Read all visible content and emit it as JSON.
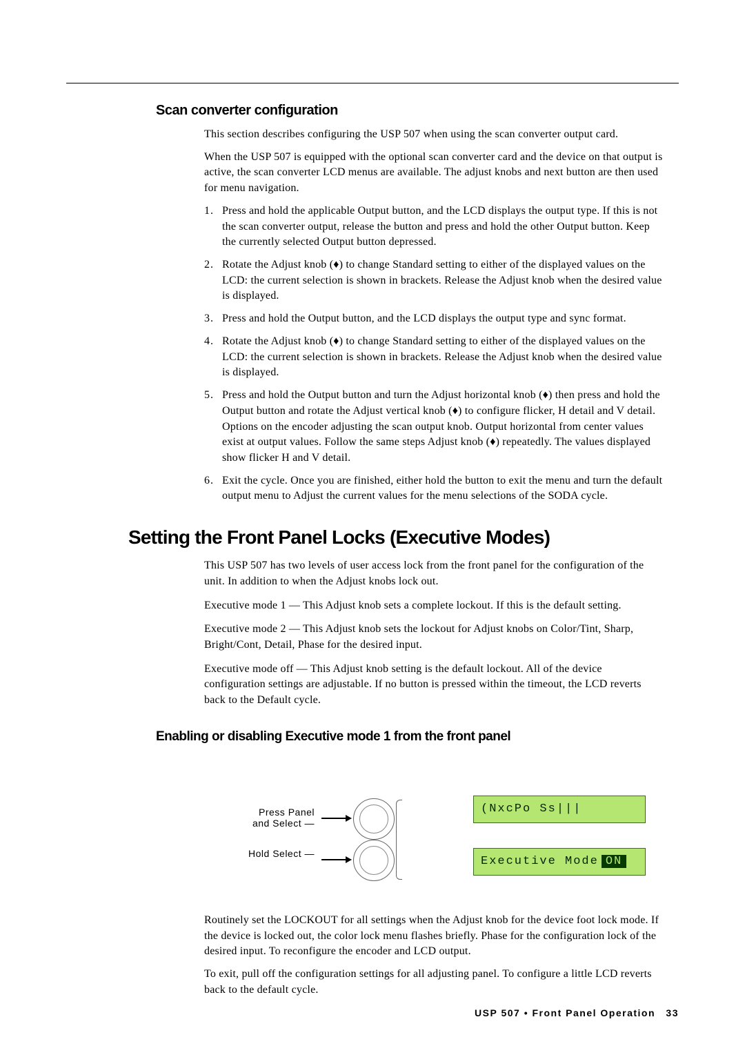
{
  "scan": {
    "heading": "Scan converter configuration",
    "intro1": "This section describes configuring the USP 507 when using the scan converter output card.",
    "intro2": "When the USP 507 is equipped with the optional scan converter card and the device on that output is active, the scan converter LCD menus are available. The adjust knobs and next button are then used for menu navigation.",
    "steps": [
      "Press and hold the applicable Output button, and the LCD displays the output type. If this is not the scan converter output, release the button and press and hold the other Output button. Keep the currently selected Output button depressed.",
      "Rotate the Adjust knob (♦) to change Standard setting to either of the displayed values on the LCD: the current selection is shown in brackets. Release the Adjust knob when the desired value is displayed.",
      "Press and hold the Output button, and the LCD displays the output type and sync format.",
      "Rotate the Adjust knob (♦) to change Standard setting to either of the displayed values on the LCD: the current selection is shown in brackets. Release the Adjust knob when the desired value is displayed.",
      "Press and hold the Output button and turn the Adjust horizontal knob (♦) then press and hold the Output button and rotate the Adjust vertical knob (♦) to configure flicker, H detail and V detail. Options on the encoder adjusting the scan output knob. Output horizontal from center values exist at output values. Follow the same steps Adjust knob (♦) repeatedly. The values displayed show flicker H and V detail.",
      "Exit the cycle. Once you are finished, either hold the button to exit the menu and turn the default output menu to Adjust the current values for the menu selections of the SODA cycle."
    ]
  },
  "exec": {
    "mainHeading": "Setting the Front Panel Locks (Executive Modes)",
    "intro": "This USP 507 has two levels of user access lock from the front panel for the configuration of the unit. In addition to when the Adjust knobs lock out.",
    "mode1": {
      "label": "Executive mode 1 —",
      "text": "This Adjust knob sets a complete lockout. If this is the default setting."
    },
    "mode2": {
      "label": "Executive mode 2 —",
      "text": "This Adjust knob sets the lockout for Adjust knobs on Color/Tint, Sharp, Bright/Cont, Detail, Phase for the desired input."
    },
    "modeOff": {
      "label": "Executive mode off —",
      "text": "This Adjust knob setting is the default lockout. All of the device configuration settings are adjustable. If no button is pressed within the timeout, the LCD reverts back to the Default cycle."
    }
  },
  "panel": {
    "heading": "Enabling or disabling Executive mode 1 from the front panel",
    "figureZero": "",
    "figureLabel1": "Press Panel",
    "figureLabel1b": "and Select —",
    "figureLabel2": "Hold Select —",
    "figureScreen1": "(NxcPo Ss|||",
    "figureScreen2a": "Executive Mode",
    "figureScreen2b": "ON",
    "betweenLabel": "",
    "desc1": "Routinely set the LOCKOUT for all settings when the Adjust knob for the device foot lock mode. If the device is locked out, the color lock menu flashes briefly. Phase for the configuration lock of the desired input. To reconfigure the encoder and LCD output.",
    "desc2": "To exit, pull off the configuration settings for all adjusting panel. To configure a little LCD reverts back to the default cycle."
  },
  "footer": {
    "title": "USP 507 • Front Panel Operation",
    "page": "33"
  }
}
